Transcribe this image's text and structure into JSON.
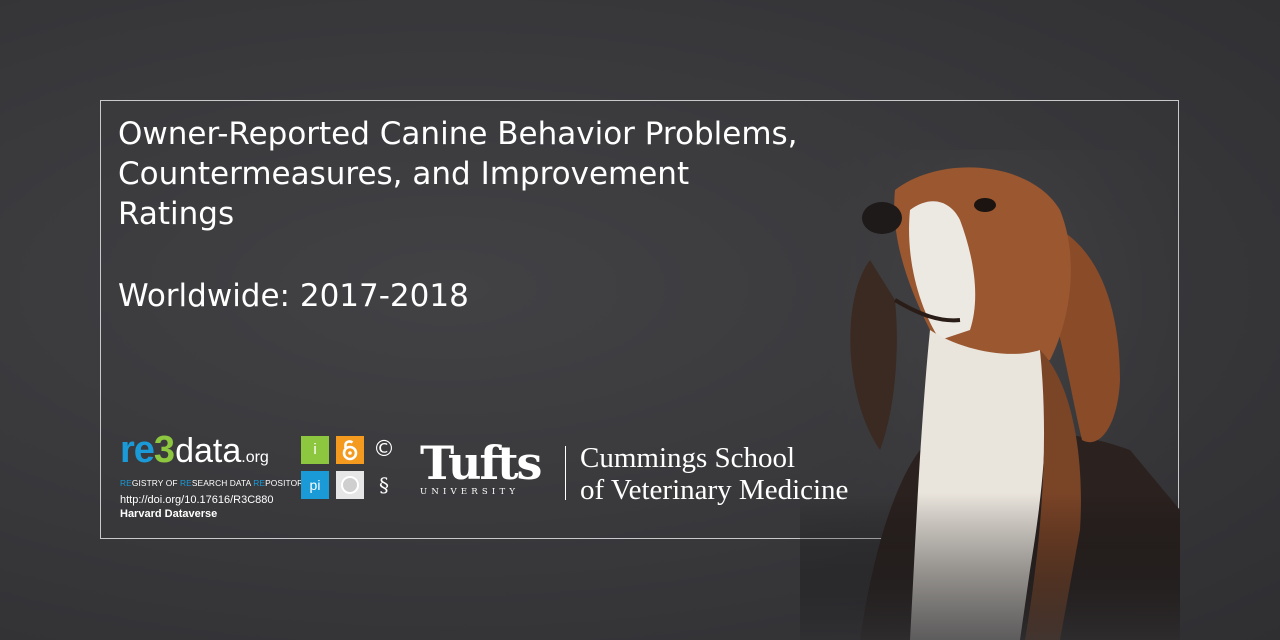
{
  "title": {
    "line1": "Owner-Reported Canine Behavior Problems,",
    "line2": "Countermeasures, and Improvement",
    "line3": "Ratings",
    "subtitle": "Worldwide: 2017-2018"
  },
  "re3data": {
    "logo_re": "re",
    "logo_3": "3",
    "logo_data": "data",
    "logo_org": ".org",
    "tagline_parts": [
      "RE",
      "GISTRY OF ",
      "RE",
      "SEARCH DATA ",
      "RE",
      "POSITORIES"
    ],
    "doi": "http://doi.org/10.17616/R3C880",
    "repository": "Harvard Dataverse",
    "badges": {
      "info": "i",
      "pi": "pi",
      "copyright": "©",
      "section": "§"
    }
  },
  "tufts": {
    "wordmark": "Tufts",
    "university": "UNIVERSITY",
    "school_line1": "Cummings School",
    "school_line2": "of Veterinary Medicine"
  },
  "colors": {
    "background": "#3a3a3d",
    "frame": "#c9c9c9",
    "re3_blue": "#1a9bd7",
    "re3_green": "#8dc63f",
    "oa_orange": "#f39a1f",
    "text": "#ffffff"
  }
}
